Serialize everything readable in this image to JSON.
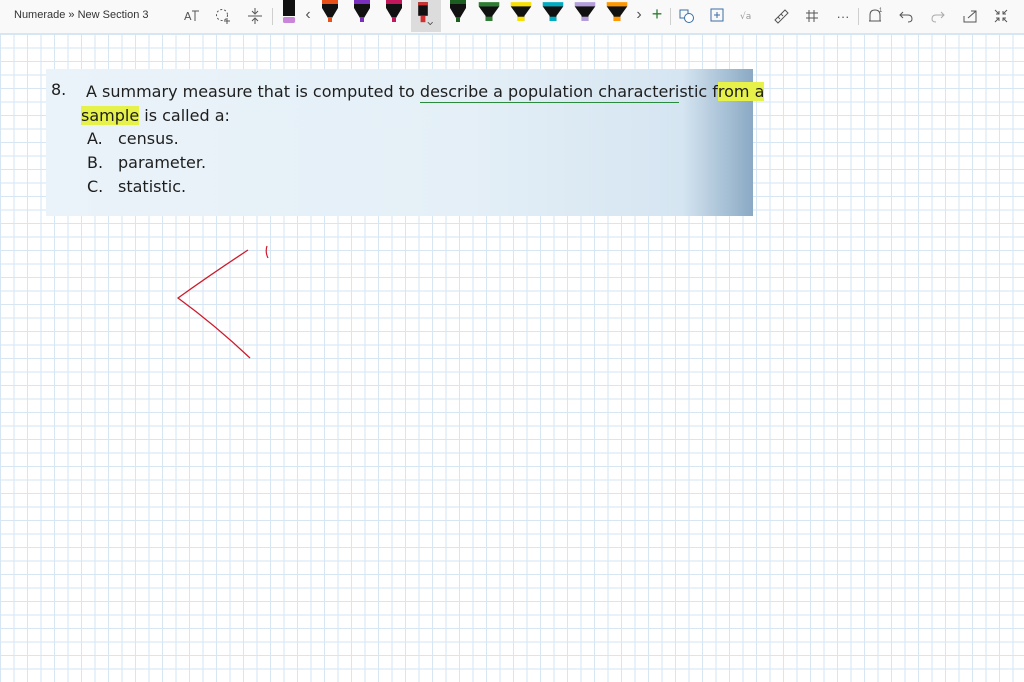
{
  "window": {
    "breadcrumb": "Numerade » New Section 3"
  },
  "toolbar": {
    "left_tools": [
      "lasso-text-icon",
      "lasso-select-icon",
      "insert-space-icon"
    ],
    "pen_colors": [
      "#000000",
      "#e8501a",
      "#7a2fbf",
      "#c2185b",
      "#d32f2f",
      "#1b5e20",
      "#2e7d32",
      "#f9e000",
      "#00acc1",
      "#b39ddb",
      "#ff9800"
    ],
    "prev_glyph": "‹",
    "next_glyph": "›",
    "add_glyph": "+",
    "more_glyph": "···",
    "right_tools": [
      "shapes-icon",
      "convert-icon",
      "math-icon",
      "ruler-icon",
      "grid-icon",
      "more-icon",
      "bell-icon",
      "undo-icon",
      "redo-icon",
      "share-icon",
      "collapse-icon"
    ]
  },
  "question": {
    "number": "8.",
    "text_before": "A summary measure that is computed to ",
    "text_underlined": "describe a population characteri",
    "text_underlined_tail": "stic f",
    "text_highlight1": "rom a",
    "text_line2_highlight": "sample",
    "text_line2_rest": " is called a:",
    "options": [
      {
        "letter": "A.",
        "text": "census."
      },
      {
        "letter": "B.",
        "text": "parameter."
      },
      {
        "letter": "C.",
        "text": "statistic."
      }
    ]
  },
  "colors": {
    "ink": "#d0192b",
    "highlight": "#e6f24a",
    "underline": "#2a8a3e",
    "grid": "#d6e6f3"
  }
}
